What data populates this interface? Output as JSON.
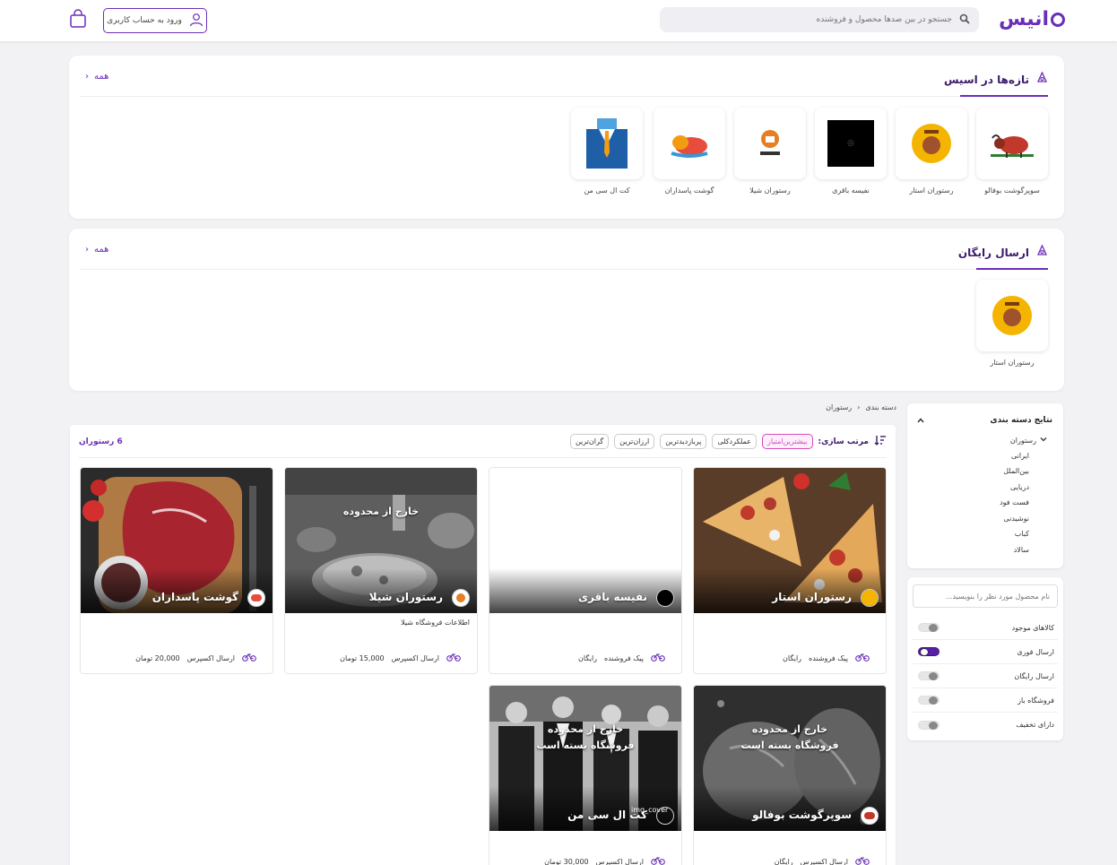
{
  "header": {
    "logo_text": "انیس",
    "search_placeholder": "جستجو در بین صدها محصول و فروشنده",
    "login_label": "ورود به حساب کاربری"
  },
  "new_section": {
    "title": "تازه‌ها در اسیس",
    "all_label": "همه",
    "items": [
      {
        "name": "سوپرگوشت بوفالو",
        "icon": "buffalo-logo"
      },
      {
        "name": "رستوران استار",
        "icon": "star-restaurant-logo"
      },
      {
        "name": "نفیسه باقری",
        "icon": "nafiseh-logo"
      },
      {
        "name": "رستوران شیلا",
        "icon": "shila-logo"
      },
      {
        "name": "گوشت پاسداران",
        "icon": "pasdaran-logo"
      },
      {
        "name": "کت ال سی من",
        "icon": "suit-logo"
      }
    ]
  },
  "free_section": {
    "title": "ارسال رایگان",
    "all_label": "همه",
    "items": [
      {
        "name": "رستوران استار",
        "icon": "star-restaurant-logo"
      }
    ]
  },
  "sidebar": {
    "category_title": "نتایج دسته بندی",
    "parent_category": "رستوران",
    "categories": [
      "ایرانی",
      "بین‌الملل",
      "دریایی",
      "فست فود",
      "نوشیدنی",
      "کباب",
      "سالاد"
    ],
    "product_search_placeholder": "نام محصول مورد نظر را بنویسید...",
    "filters": [
      {
        "label": "کالاهای موجود",
        "on": false
      },
      {
        "label": "ارسال فوری",
        "on": true
      },
      {
        "label": "ارسال رایگان",
        "on": false
      },
      {
        "label": "فروشگاه باز",
        "on": false
      },
      {
        "label": "دارای تخفیف",
        "on": false
      }
    ]
  },
  "breadcrumb": {
    "root": "دسته بندی",
    "current": "رستوران"
  },
  "listing": {
    "sort_label": "مرتب سازی:",
    "sort_options": [
      "بیشترین‌امتیاز",
      "عملکردکلی",
      "پربازدیدترین",
      "ارزان‌ترین",
      "گران‌ترین"
    ],
    "active_sort": "بیشترین‌امتیاز",
    "count": "6 رستوران",
    "cards": [
      {
        "name": "رستوران استار",
        "overlay": "",
        "info": "",
        "delivery": "پیک فروشنده",
        "price": "رایگان"
      },
      {
        "name": "نفیسه باقری",
        "overlay": "",
        "info": "",
        "delivery": "پیک فروشنده",
        "price": "رایگان"
      },
      {
        "name": "رستوران شیلا",
        "overlay": "خارج از محدوده",
        "info": "اطلاعات فروشگاه شیلا",
        "delivery": "ارسال اکسپرس",
        "price": "15,000 تومان"
      },
      {
        "name": "گوشت پاسداران",
        "overlay": "",
        "info": "",
        "delivery": "ارسال اکسپرس",
        "price": "20,000 تومان"
      },
      {
        "name": "سوپرگوشت بوفالو",
        "overlay_line1": "خارج از محدوده",
        "overlay_line2": "فروشگاه بسته است",
        "info": "",
        "delivery": "ارسال اکسپرس",
        "price": "رایگان"
      },
      {
        "name": "کت ال سی من",
        "overlay_line1": "خارج از محدوده",
        "overlay_line2": "فروشگاه بسته است",
        "info": "",
        "delivery": "ارسال اکسپرس",
        "price": "30,000 تومان",
        "img_alt": "img_cover"
      }
    ]
  },
  "colors": {
    "brand": "#6a2fb7",
    "active_chip": "#d44bbf"
  }
}
